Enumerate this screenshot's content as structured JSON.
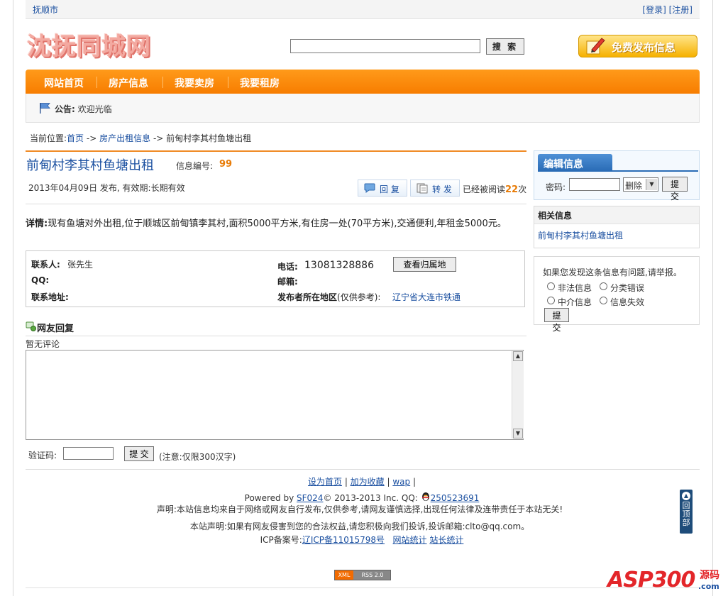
{
  "topbar": {
    "city": "抚顺市",
    "login": "[登录]",
    "register": "[注册]"
  },
  "logo": {
    "text": "沈抚同城网"
  },
  "search": {
    "placeholder": "",
    "button": "搜 索"
  },
  "publish": {
    "label": "免费发布信息"
  },
  "nav": {
    "items": [
      "网站首页",
      "房产信息",
      "我要卖房",
      "我要租房"
    ]
  },
  "notice": {
    "label": "公告:",
    "text": "欢迎光临"
  },
  "breadcrumb": {
    "prefix": "当前位置:",
    "home": "首页",
    "sep": "->",
    "category": "房产出租信息",
    "current": "前甸村李其村鱼塘出租"
  },
  "post": {
    "title": "前甸村李其村鱼塘出租",
    "id_label": "信息编号:",
    "id": "99",
    "meta": "2013年04月09日 发布, 有效期:长期有效",
    "reply_btn": "回 复",
    "forward_btn": "转 发",
    "read_prefix": "已经被阅读",
    "read_count": "22",
    "read_suffix": "次",
    "detail_label": "详情:",
    "detail": "现有鱼塘对外出租,位于顺城区前甸镇李其村,面积5000平方米,有住房一处(70平方米),交通便利,年租金5000元。"
  },
  "contact": {
    "name_label": "联系人:",
    "name": "张先生",
    "phone_label": "电话:",
    "phone": "13081328886",
    "check_btn": "查看归属地",
    "qq_label": "QQ:",
    "email_label": "邮箱:",
    "address_label": "联系地址:",
    "region_label": "发布者所在地区",
    "region_note": "(仅供参考):",
    "region": "辽宁省大连市铁通"
  },
  "comments": {
    "title": "网友回复",
    "empty": "暂无评论",
    "captcha_label": "验证码:",
    "submit": "提 交",
    "note": "(注意:仅限300汉字)"
  },
  "sidebar": {
    "edit": {
      "title": "编辑信息",
      "pwd_label": "密码:",
      "action": "删除",
      "submit": "提交"
    },
    "related": {
      "title": "相关信息",
      "link": "前甸村李其村鱼塘出租"
    },
    "report": {
      "text": "如果您发现这条信息有问题,请举报。",
      "options": [
        "非法信息",
        "分类错误",
        "中介信息",
        "信息失效"
      ],
      "submit": "提交"
    }
  },
  "footer": {
    "links": [
      "设为首页",
      "加为收藏",
      "wap"
    ],
    "powered_prefix": "Powered by",
    "powered_brand": "SF024",
    "powered_suffix": "© 2013-2013 Inc. QQ:",
    "qq": "250523691",
    "decl1": "声明:本站信息均来自于网络或网友自行发布,仅供参考,请网友谨慎选择,出现任何法律及连带责任于本站无关!",
    "decl2": "本站声明:如果有网友侵害到您的合法权益,请您积极向我们投诉,投诉邮箱:clto@qq.com。",
    "icp_label": "ICP备案号:",
    "icp": "辽ICP备11015798号",
    "stats1": "网站统计",
    "stats2": "站长统计",
    "xml": "XML",
    "rss": "RSS 2.0"
  },
  "back_top": {
    "label": "回顶部"
  },
  "watermark": {
    "brand": "ASP300",
    "suffix": "源码",
    "domain": ".com"
  },
  "colors": {
    "accent": "#f77d00",
    "link": "#1a4fa0",
    "highlight": "#e87c08",
    "edit_tab": "#2a6cb6"
  }
}
